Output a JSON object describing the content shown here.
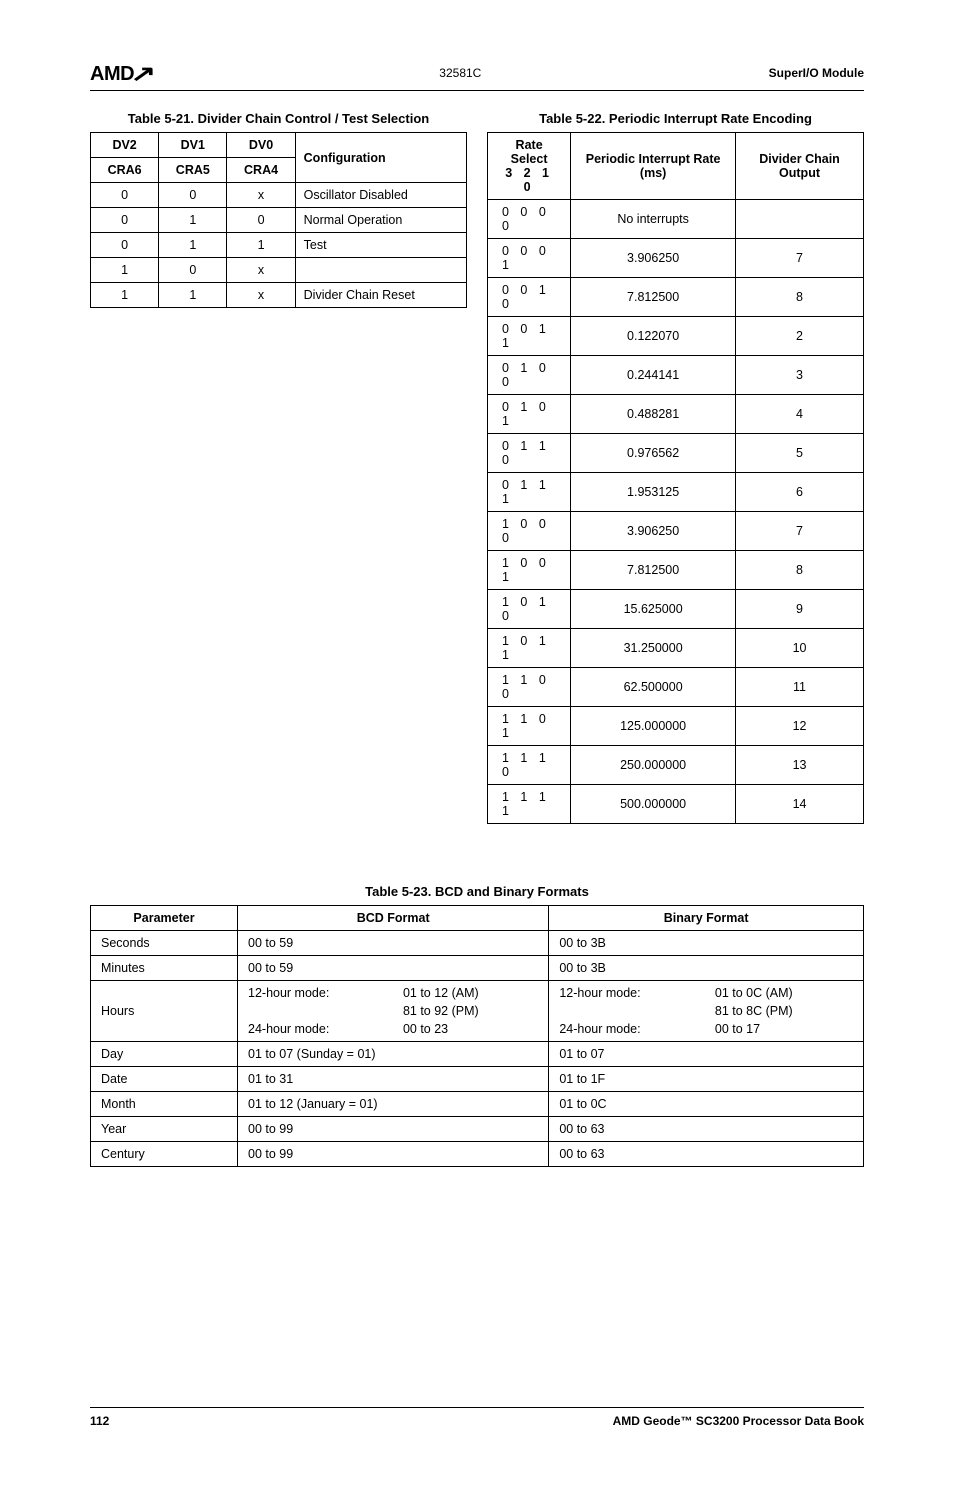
{
  "header": {
    "logo": "AMD",
    "doc_num": "32581C",
    "module": "SuperI/O Module"
  },
  "table521": {
    "caption": "Table 5-21.  Divider Chain Control / Test Selection",
    "head_top": [
      "DV2",
      "DV1",
      "DV0"
    ],
    "head_bot": [
      "CRA6",
      "CRA5",
      "CRA4",
      "Configuration"
    ],
    "rows": [
      [
        "0",
        "0",
        "x",
        "Oscillator Disabled"
      ],
      [
        "0",
        "1",
        "0",
        "Normal Operation"
      ],
      [
        "0",
        "1",
        "1",
        "Test"
      ],
      [
        "1",
        "0",
        "x",
        ""
      ],
      [
        "1",
        "1",
        "x",
        "Divider Chain Reset"
      ]
    ]
  },
  "table522": {
    "caption": "Table 5-22.  Periodic Interrupt Rate Encoding",
    "headers": {
      "rate_select": "Rate Select",
      "rate_select_sub": "3 2 1 0",
      "periodic": "Periodic Interrupt Rate (ms)",
      "divider": "Divider Chain Output"
    },
    "rows": [
      [
        "0 0 0 0",
        "No interrupts",
        ""
      ],
      [
        "0 0 0 1",
        "3.906250",
        "7"
      ],
      [
        "0 0 1 0",
        "7.812500",
        "8"
      ],
      [
        "0 0 1 1",
        "0.122070",
        "2"
      ],
      [
        "0 1 0 0",
        "0.244141",
        "3"
      ],
      [
        "0 1 0 1",
        "0.488281",
        "4"
      ],
      [
        "0 1 1 0",
        "0.976562",
        "5"
      ],
      [
        "0 1 1 1",
        "1.953125",
        "6"
      ],
      [
        "1 0 0 0",
        "3.906250",
        "7"
      ],
      [
        "1 0 0 1",
        "7.812500",
        "8"
      ],
      [
        "1 0 1 0",
        "15.625000",
        "9"
      ],
      [
        "1 0 1 1",
        "31.250000",
        "10"
      ],
      [
        "1 1 0 0",
        "62.500000",
        "11"
      ],
      [
        "1 1 0 1",
        "125.000000",
        "12"
      ],
      [
        "1 1 1 0",
        "250.000000",
        "13"
      ],
      [
        "1 1 1 1",
        "500.000000",
        "14"
      ]
    ]
  },
  "table523": {
    "caption": "Table 5-23.  BCD and Binary Formats",
    "headers": [
      "Parameter",
      "BCD Format",
      "Binary Format"
    ],
    "rows": [
      {
        "param": "Seconds",
        "bcd": "00 to 59",
        "bin": "00 to 3B"
      },
      {
        "param": "Minutes",
        "bcd": "00 to 59",
        "bin": "00 to 3B"
      },
      {
        "param": "Hours",
        "bcd_lines": [
          [
            "12-hour mode:",
            "01 to 12 (AM)"
          ],
          [
            "",
            "81 to 92 (PM)"
          ],
          [
            "24-hour mode:",
            "00 to 23"
          ]
        ],
        "bin_lines": [
          [
            "12-hour mode:",
            "01 to 0C (AM)"
          ],
          [
            "",
            "81 to 8C (PM)"
          ],
          [
            "24-hour mode:",
            "00 to 17"
          ]
        ]
      },
      {
        "param": "Day",
        "bcd": "01 to 07 (Sunday = 01)",
        "bin": "01 to 07"
      },
      {
        "param": "Date",
        "bcd": "01 to 31",
        "bin": "01 to 1F"
      },
      {
        "param": "Month",
        "bcd": "01 to 12 (January = 01)",
        "bin": "01 to 0C"
      },
      {
        "param": "Year",
        "bcd": "00 to 99",
        "bin": "00 to 63"
      },
      {
        "param": "Century",
        "bcd": "00 to 99",
        "bin": "00 to 63"
      }
    ]
  },
  "footer": {
    "page": "112",
    "book": "AMD Geode™ SC3200 Processor Data Book"
  }
}
